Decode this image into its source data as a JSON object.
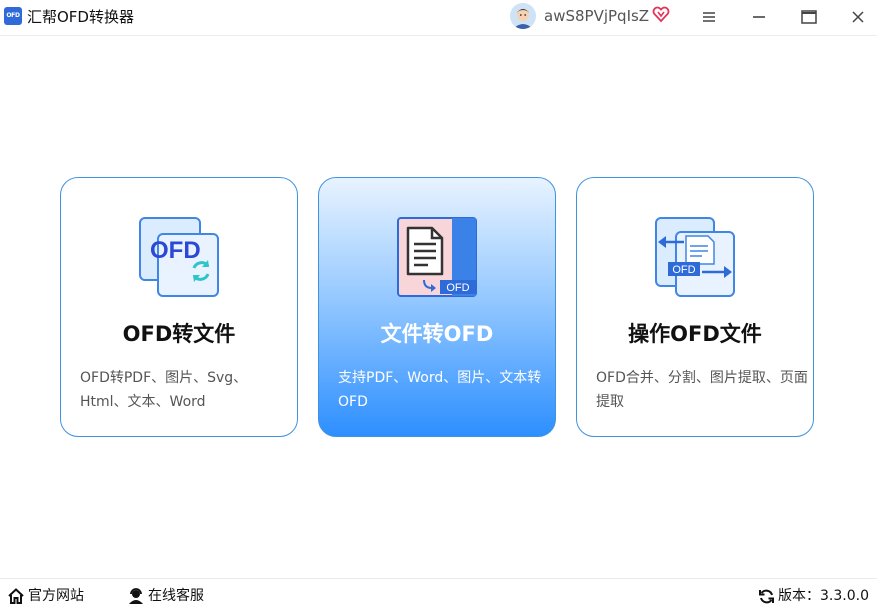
{
  "titlebar": {
    "app_logo_text": "OFD",
    "title": "汇帮OFD转换器",
    "username": "awS8PVjPqIsZ",
    "icons": [
      "avatar",
      "vip-heart-icon",
      "menu-icon",
      "minimize-icon",
      "maximize-icon",
      "close-icon"
    ]
  },
  "cards": [
    {
      "title": "OFD转文件",
      "desc": "OFD转PDF、图片、Svg、Html、文本、Word",
      "icon": "ofd-to-file-icon",
      "active": false
    },
    {
      "title": "文件转OFD",
      "desc": "支持PDF、Word、图片、文本转OFD",
      "icon": "file-to-ofd-icon",
      "active": true,
      "icon_badge": "OFD"
    },
    {
      "title": "操作OFD文件",
      "desc": "OFD合并、分割、图片提取、页面提取",
      "icon": "operate-ofd-icon",
      "active": false,
      "icon_badge": "OFD"
    }
  ],
  "footer": {
    "website": "官方网站",
    "service": "在线客服",
    "version": "版本：3.3.0.0"
  },
  "colors": {
    "accent": "#2d8fff",
    "card_border": "#3f93e0",
    "vip": "#e5335a"
  }
}
